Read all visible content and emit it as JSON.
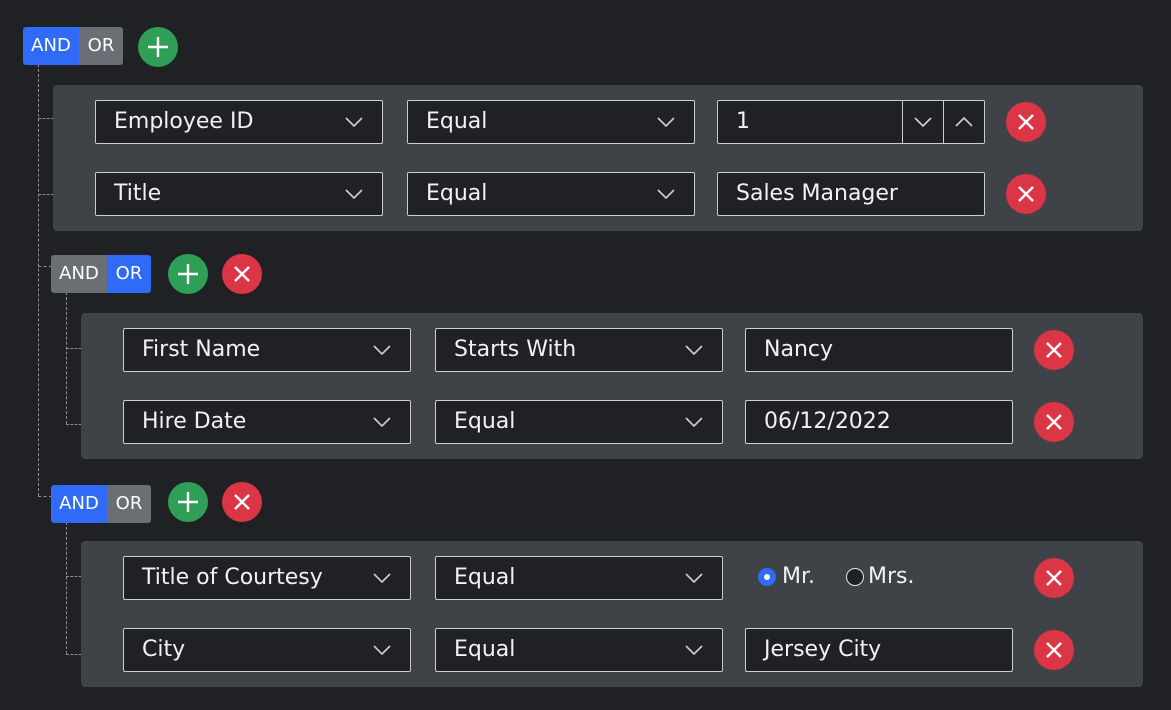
{
  "colors": {
    "background": "#202125",
    "panel": "#3f4246",
    "active_toggle": "#2f6bf6",
    "inactive_toggle": "#6b6e74",
    "add_button": "#2f9e57",
    "remove_button": "#dc3545"
  },
  "icons": {
    "add": "plus-icon",
    "remove": "close-icon",
    "dropdown": "chevron-down-icon",
    "spin_up": "chevron-up-icon"
  },
  "root": {
    "and_label": "AND",
    "or_label": "OR",
    "selected": "AND",
    "rules": [
      {
        "field": "Employee ID",
        "operator": "Equal",
        "value": "1",
        "value_type": "numeric"
      },
      {
        "field": "Title",
        "operator": "Equal",
        "value": "Sales Manager",
        "value_type": "text"
      }
    ],
    "groups": [
      {
        "and_label": "AND",
        "or_label": "OR",
        "selected": "OR",
        "rules": [
          {
            "field": "First Name",
            "operator": "Starts With",
            "value": "Nancy",
            "value_type": "text"
          },
          {
            "field": "Hire Date",
            "operator": "Equal",
            "value": "06/12/2022",
            "value_type": "date"
          }
        ]
      },
      {
        "and_label": "AND",
        "or_label": "OR",
        "selected": "AND",
        "rules": [
          {
            "field": "Title of Courtesy",
            "operator": "Equal",
            "value_type": "radio",
            "options": [
              {
                "label": "Mr.",
                "checked": true
              },
              {
                "label": "Mrs.",
                "checked": false
              }
            ]
          },
          {
            "field": "City",
            "operator": "Equal",
            "value": "Jersey City",
            "value_type": "text"
          }
        ]
      }
    ]
  }
}
